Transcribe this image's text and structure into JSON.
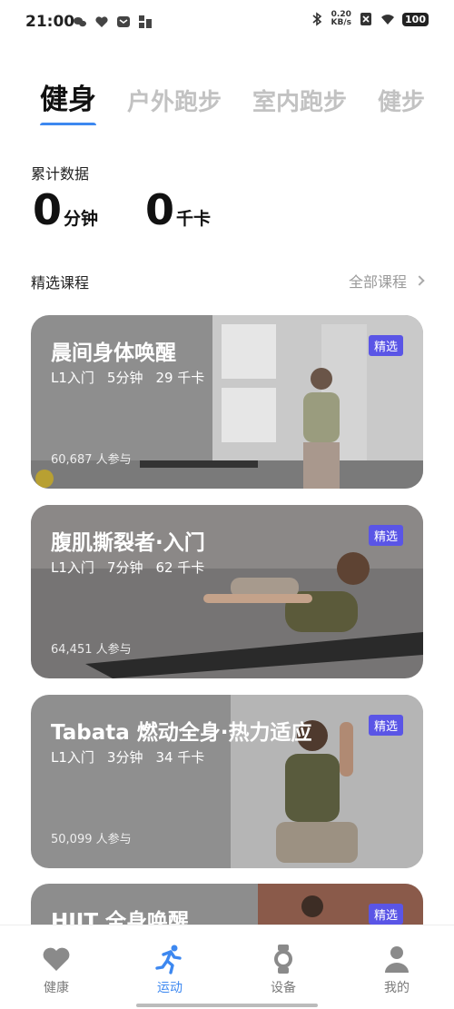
{
  "status_bar": {
    "time": "21:00",
    "net_speed_value": "0.20",
    "net_speed_unit": "KB/s",
    "battery": "100"
  },
  "tabs": [
    {
      "label": "健身",
      "active": true
    },
    {
      "label": "户外跑步",
      "active": false
    },
    {
      "label": "室内跑步",
      "active": false
    },
    {
      "label": "健步",
      "active": false
    }
  ],
  "stats": {
    "label": "累计数据",
    "minutes_value": "0",
    "minutes_unit": "分钟",
    "kcal_value": "0",
    "kcal_unit": "千卡"
  },
  "courses_section": {
    "title": "精选课程",
    "all_label": "全部课程"
  },
  "courses": [
    {
      "title": "晨间身体唤醒",
      "level": "L1入门",
      "duration": "5分钟",
      "calories": "29 千卡",
      "participants": "60,687 人参与",
      "badge": "精选"
    },
    {
      "title": "腹肌撕裂者·入门",
      "level": "L1入门",
      "duration": "7分钟",
      "calories": "62 千卡",
      "participants": "64,451 人参与",
      "badge": "精选"
    },
    {
      "title": "Tabata 燃动全身·热力适应",
      "level": "L1入门",
      "duration": "3分钟",
      "calories": "34 千卡",
      "participants": "50,099 人参与",
      "badge": "精选"
    },
    {
      "title": "HIIT 全身唤醒",
      "level": "",
      "duration": "",
      "calories": "",
      "participants": "",
      "badge": "精选"
    }
  ],
  "bottom_nav": [
    {
      "label": "健康",
      "icon": "heart-icon",
      "active": false
    },
    {
      "label": "运动",
      "icon": "running-icon",
      "active": true
    },
    {
      "label": "设备",
      "icon": "watch-icon",
      "active": false
    },
    {
      "label": "我的",
      "icon": "person-icon",
      "active": false
    }
  ],
  "colors": {
    "accent": "#3d88f0",
    "badge": "#5a55e6"
  }
}
